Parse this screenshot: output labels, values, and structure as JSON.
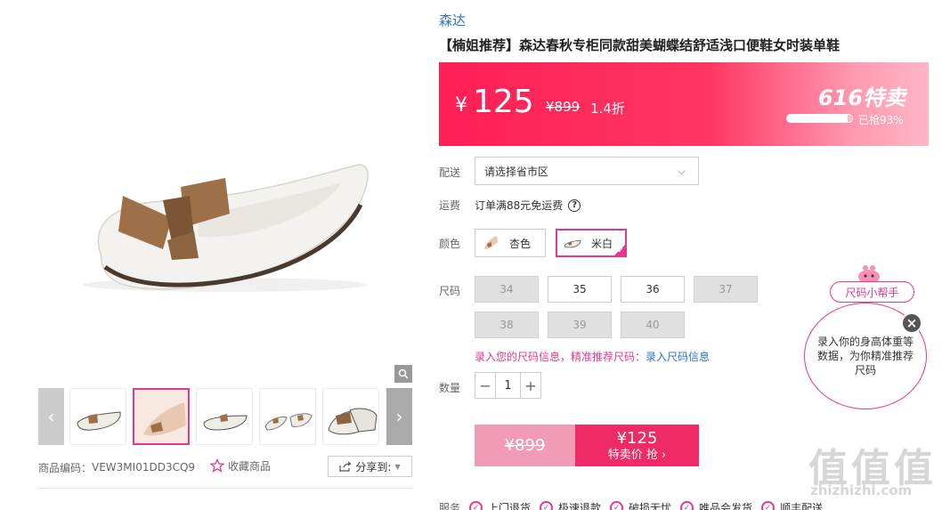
{
  "product": {
    "brand": "森达",
    "title": "【楠姐推荐】森达春秋专柜同款甜美蝴蝶结舒适浅口便鞋女时装单鞋",
    "code_label": "商品编码：",
    "code": "VEW3MI01DD3CQ9",
    "favorite_label": "收藏商品",
    "share_label": "分享到:"
  },
  "price": {
    "currency": "¥",
    "value": "125",
    "original": "¥899",
    "discount": "1.4折",
    "promo_title": "616特卖",
    "progress_text": "已抢93%",
    "progress_percent": 93
  },
  "delivery": {
    "label": "配送",
    "placeholder": "请选择省市区"
  },
  "shipping": {
    "label": "运费",
    "text": "订单满88元免运费"
  },
  "colors": {
    "label": "颜色",
    "options": [
      {
        "name": "杏色",
        "selected": false
      },
      {
        "name": "米白",
        "selected": true
      }
    ]
  },
  "sizes": {
    "label": "尺码",
    "options": [
      {
        "value": "34",
        "available": false
      },
      {
        "value": "35",
        "available": true
      },
      {
        "value": "36",
        "available": true
      },
      {
        "value": "37",
        "available": false
      },
      {
        "value": "38",
        "available": false
      },
      {
        "value": "39",
        "available": false
      },
      {
        "value": "40",
        "available": false
      }
    ],
    "info_pink": "录入您的尺码信息，精准推荐尺码：",
    "info_link": "录入尺码信息"
  },
  "quantity": {
    "label": "数量",
    "value": "1"
  },
  "buy": {
    "original": "¥899",
    "price": "¥125",
    "action": "特卖价 抢 ›"
  },
  "services": {
    "label": "服务",
    "items": [
      "上门退货",
      "极速退款",
      "破损无忧",
      "唯品会发货",
      "顺丰配送"
    ]
  },
  "size_helper": {
    "tag": "尺码小帮手",
    "bubble": "录入你的身高体重等数据，为你精准推荐尺码"
  },
  "watermark": {
    "logo": "值值值",
    "url": "zhizhizhi.com"
  },
  "colors_theme": {
    "accent": "#e4388e",
    "price_red": "#ff1f55",
    "link_blue": "#2a76c6"
  }
}
